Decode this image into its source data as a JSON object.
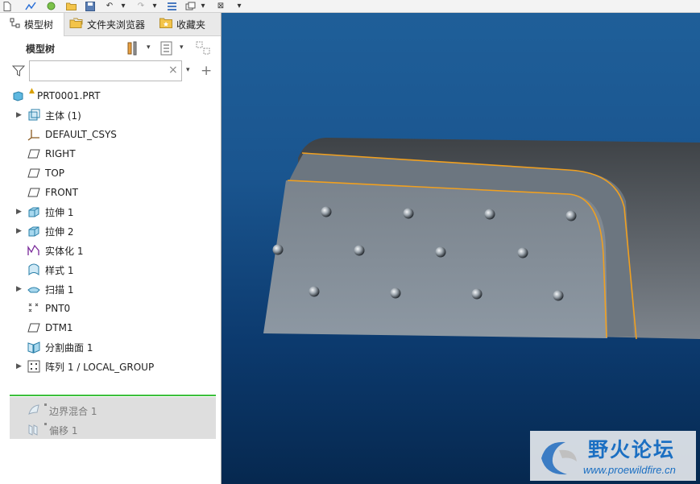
{
  "tabs": [
    {
      "label": "模型树",
      "icon": "model-tree-icon"
    },
    {
      "label": "文件夹浏览器",
      "icon": "folder-browser-icon"
    },
    {
      "label": "收藏夹",
      "icon": "favorites-icon"
    }
  ],
  "panel": {
    "title": "模型树"
  },
  "search": {
    "value": "",
    "placeholder": "",
    "clear_glyph": "×"
  },
  "tree": {
    "root": "PRT0001.PRT",
    "items": [
      {
        "label": "主体 (1)",
        "icon": "body-icon",
        "expandable": true
      },
      {
        "label": "DEFAULT_CSYS",
        "icon": "csys-icon",
        "expandable": false
      },
      {
        "label": "RIGHT",
        "icon": "datum-plane-icon",
        "expandable": false
      },
      {
        "label": "TOP",
        "icon": "datum-plane-icon",
        "expandable": false
      },
      {
        "label": "FRONT",
        "icon": "datum-plane-icon",
        "expandable": false
      },
      {
        "label": "拉伸 1",
        "icon": "extrude-icon",
        "expandable": true
      },
      {
        "label": "拉伸 2",
        "icon": "extrude-icon",
        "expandable": true
      },
      {
        "label": "实体化 1",
        "icon": "solidify-icon",
        "expandable": false
      },
      {
        "label": "样式 1",
        "icon": "style-icon",
        "expandable": false
      },
      {
        "label": "扫描 1",
        "icon": "sweep-icon",
        "expandable": true
      },
      {
        "label": "PNT0",
        "icon": "datum-point-icon",
        "expandable": false
      },
      {
        "label": "DTM1",
        "icon": "datum-plane-icon",
        "expandable": false
      },
      {
        "label": "分割曲面 1",
        "icon": "split-surface-icon",
        "expandable": false
      },
      {
        "label": "阵列 1 / LOCAL_GROUP",
        "icon": "pattern-icon",
        "expandable": true
      }
    ],
    "suppressed": [
      {
        "label": "边界混合 1",
        "icon": "boundary-blend-icon"
      },
      {
        "label": "偏移 1",
        "icon": "offset-icon"
      }
    ]
  },
  "watermark": {
    "title": "野火论坛",
    "url": "www.proewildfire.cn"
  },
  "colors": {
    "viewport_top": "#1f5f99",
    "viewport_bottom": "#06284f",
    "edge_highlight": "#f0a020",
    "insert_line": "#3cbf3c"
  }
}
